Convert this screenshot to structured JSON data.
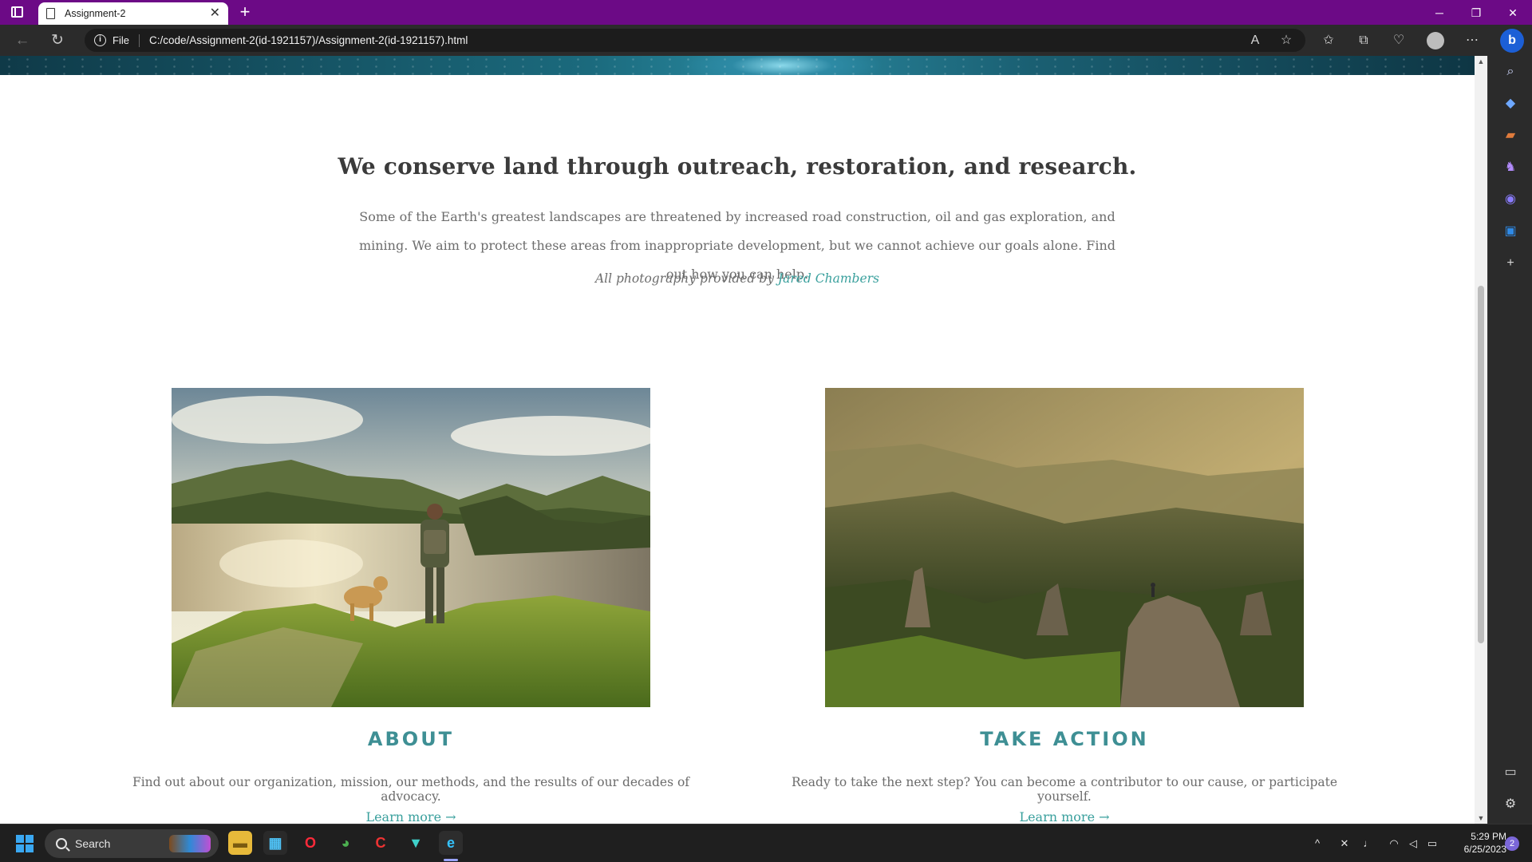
{
  "browser": {
    "tab_title": "Assignment-2",
    "tab_close": "✕",
    "new_tab": "+",
    "file_label": "File",
    "url": "C:/code/Assignment-2(id-1921157)/Assignment-2(id-1921157).html",
    "theme_color": "#6c0a86"
  },
  "page": {
    "headline": "We conserve land through outreach, restoration, and research.",
    "lead": "Some of the Earth's greatest landscapes are threatened by increased road construction, oil and gas exploration, and mining. We aim to protect these areas from inappropriate development, but we cannot achieve our goals alone. Find out how you can help.",
    "credit_prefix": "All photography provided by",
    "credit_name": "Jared Chambers",
    "accent_color": "#3aa09d",
    "cards": [
      {
        "title": "ABOUT",
        "text": "Find out about our organization, mission, our methods, and the results of our decades of advocacy.",
        "link": "Learn more →"
      },
      {
        "title": "TAKE ACTION",
        "text": "Ready to take the next step? You can become a contributor to our cause, or participate yourself.",
        "link": "Learn more →"
      }
    ]
  },
  "taskbar": {
    "search_label": "Search",
    "time": "5:29 PM",
    "date": "6/25/2023",
    "notification_count": "2"
  }
}
